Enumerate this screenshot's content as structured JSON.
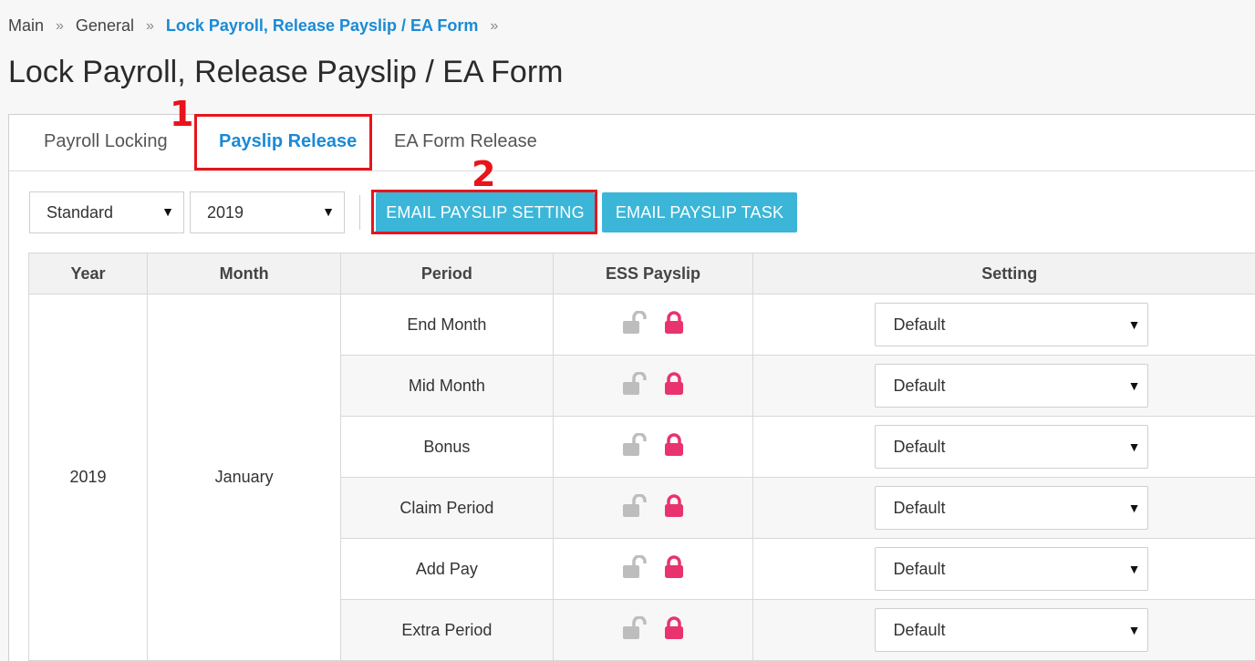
{
  "breadcrumb": {
    "items": [
      "Main",
      "General",
      "Lock Payroll, Release Payslip / EA Form"
    ],
    "separator": "»"
  },
  "page_title": "Lock Payroll, Release Payslip / EA Form",
  "tabs": [
    {
      "label": "Payroll Locking",
      "active": false
    },
    {
      "label": "Payslip Release",
      "active": true
    },
    {
      "label": "EA Form Release",
      "active": false
    }
  ],
  "annotations": {
    "step1": "1",
    "step2": "2"
  },
  "filters": {
    "type_value": "Standard",
    "year_value": "2019"
  },
  "buttons": {
    "email_setting": "EMAIL PAYSLIP SETTING",
    "email_task": "EMAIL PAYSLIP TASK"
  },
  "table": {
    "headers": [
      "Year",
      "Month",
      "Period",
      "ESS Payslip",
      "Setting"
    ],
    "year": "2019",
    "month": "January",
    "rows": [
      {
        "period": "End Month",
        "setting": "Default"
      },
      {
        "period": "Mid Month",
        "setting": "Default"
      },
      {
        "period": "Bonus",
        "setting": "Default"
      },
      {
        "period": "Claim Period",
        "setting": "Default"
      },
      {
        "period": "Add Pay",
        "setting": "Default"
      },
      {
        "period": "Extra Period",
        "setting": "Default"
      }
    ]
  },
  "icons": {
    "unlock": "unlock-icon",
    "lock": "lock-icon",
    "caret": "▼"
  },
  "colors": {
    "accent": "#1a8ad6",
    "button": "#3bb6d8",
    "annotation": "#e8141b",
    "lock": "#e8336e",
    "unlock": "#bdbdbd"
  }
}
